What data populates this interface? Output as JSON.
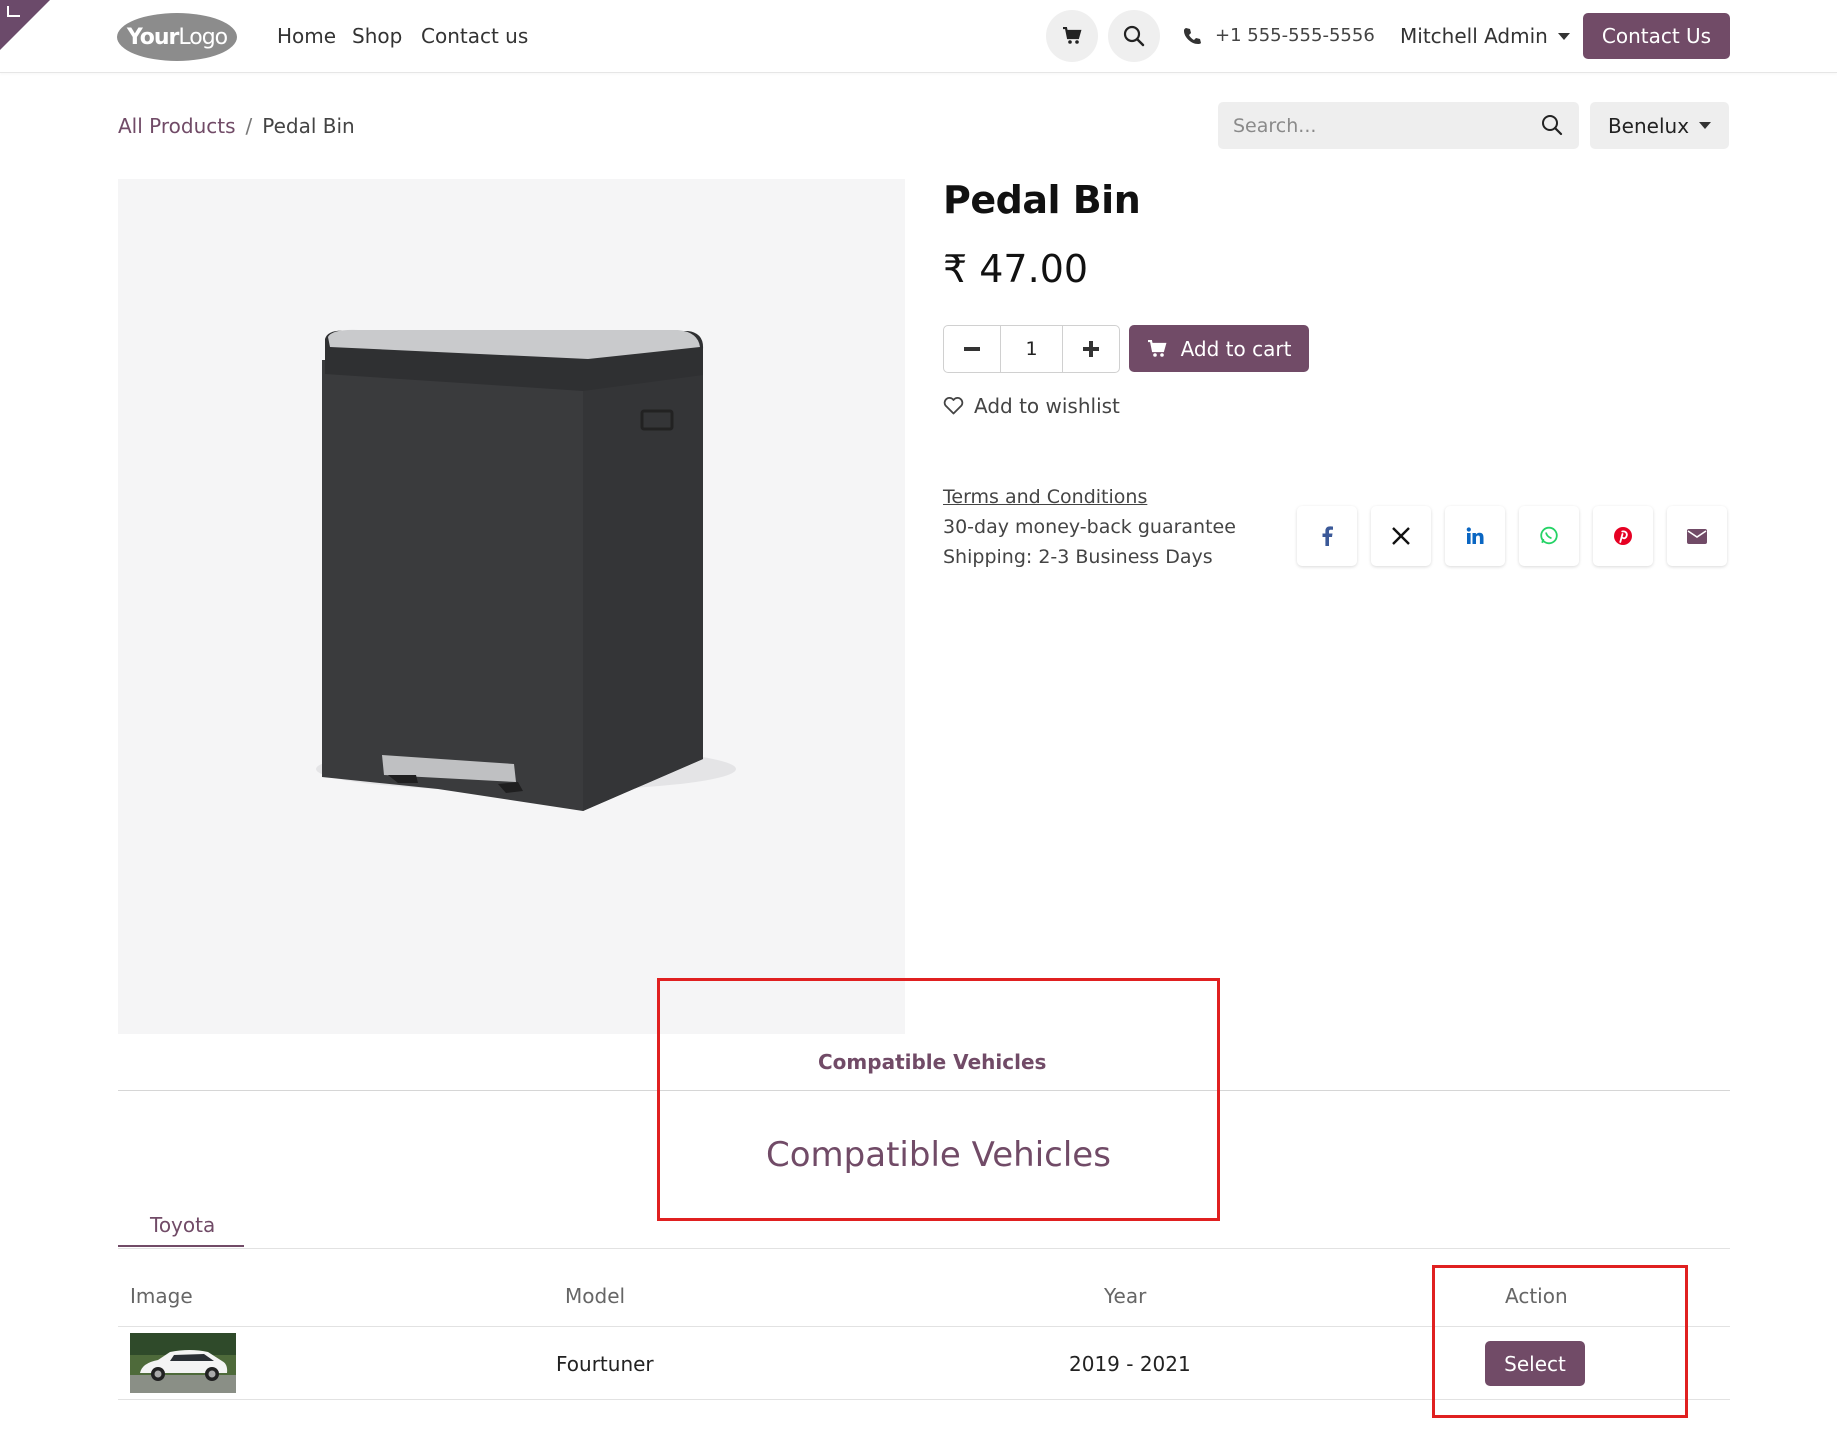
{
  "header": {
    "logo_text_bold": "Your",
    "logo_text_light": "Logo",
    "nav": [
      "Home",
      "Shop",
      "Contact us"
    ],
    "phone": "+1 555-555-5556",
    "user": "Mitchell Admin",
    "contact_button": "Contact Us"
  },
  "breadcrumb": {
    "root": "All Products",
    "sep": "/",
    "current": "Pedal Bin"
  },
  "search": {
    "placeholder": "Search..."
  },
  "region": "Benelux",
  "product": {
    "name": "Pedal Bin",
    "price": "₹ 47.00",
    "quantity": "1",
    "add_to_cart": "Add to cart",
    "wishlist": "Add to wishlist",
    "terms": "Terms and Conditions",
    "guarantee": "30-day money-back guarantee",
    "shipping": "Shipping: 2-3 Business Days"
  },
  "share_icons": [
    "facebook-icon",
    "x-icon",
    "linkedin-icon",
    "whatsapp-icon",
    "pinterest-icon",
    "email-icon"
  ],
  "tabs": {
    "active": "Compatible Vehicles"
  },
  "section": {
    "title": "Compatible Vehicles",
    "brand_tab": "Toyota",
    "columns": [
      "Image",
      "Model",
      "Year",
      "Action"
    ],
    "rows": [
      {
        "model": "Fourtuner",
        "year": "2019 - 2021",
        "action": "Select"
      }
    ]
  },
  "colors": {
    "brand": "#714b67",
    "highlight": "#e02020"
  }
}
